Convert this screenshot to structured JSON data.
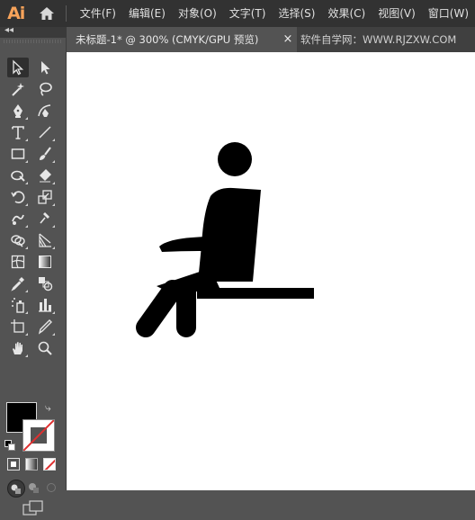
{
  "app": {
    "logo_text": "Ai",
    "logo_color": "#f7a35a"
  },
  "menu": {
    "items": [
      "文件(F)",
      "编辑(E)",
      "对象(O)",
      "文字(T)",
      "选择(S)",
      "效果(C)",
      "视图(V)",
      "窗口(W)"
    ]
  },
  "tab": {
    "title": "未标题-1* @ 300% (CMYK/GPU 预览)",
    "close": "×",
    "watermark": "软件自学网：WWW.RJZXW.COM"
  },
  "toolbar": {
    "collapse": "◂◂",
    "tools": [
      "selection-tool",
      "direct-selection-tool",
      "magic-wand-tool",
      "lasso-tool",
      "pen-tool",
      "curvature-tool",
      "type-tool",
      "line-segment-tool",
      "rectangle-tool",
      "paintbrush-tool",
      "shaper-tool",
      "eraser-tool",
      "rotate-tool",
      "scale-tool",
      "warp-tool",
      "puppet-warp-tool",
      "shape-builder-tool",
      "perspective-grid-tool",
      "mesh-tool",
      "gradient-tool",
      "eyedropper-tool",
      "blend-tool",
      "symbol-sprayer-tool",
      "column-graph-tool",
      "artboard-tool",
      "slice-tool",
      "hand-tool",
      "zoom-tool"
    ],
    "fill_color": "#000000",
    "stroke_color": "none"
  },
  "artwork": {
    "subject": "seated-person-pictogram",
    "fill": "#000000"
  }
}
